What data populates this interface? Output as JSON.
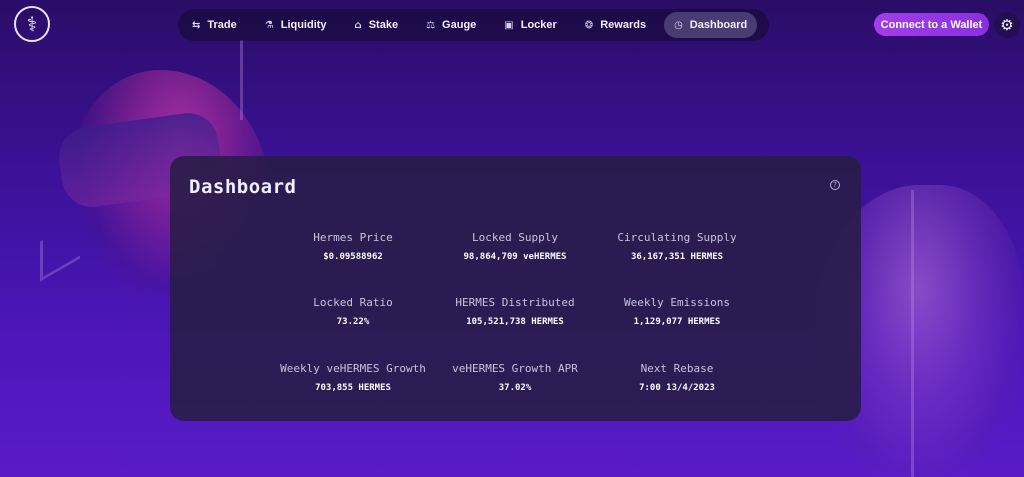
{
  "nav": {
    "items": [
      {
        "label": "Trade",
        "icon": "swap-arrows-icon",
        "glyph": "⇆"
      },
      {
        "label": "Liquidity",
        "icon": "flask-icon",
        "glyph": "⚗"
      },
      {
        "label": "Stake",
        "icon": "bank-icon",
        "glyph": "⌂"
      },
      {
        "label": "Gauge",
        "icon": "scales-icon",
        "glyph": "⚖"
      },
      {
        "label": "Locker",
        "icon": "lockbox-icon",
        "glyph": "▣"
      },
      {
        "label": "Rewards",
        "icon": "coins-icon",
        "glyph": "❂"
      },
      {
        "label": "Dashboard",
        "icon": "dashboard-icon",
        "glyph": "◷"
      }
    ],
    "active": "Dashboard"
  },
  "header": {
    "connect_label": "Connect to a Wallet",
    "logo_glyph": "⚕",
    "gear_glyph": "⚙"
  },
  "dashboard": {
    "title": "Dashboard",
    "help_glyph": "?",
    "stats": [
      {
        "label": "Hermes Price",
        "value": "$0.09588962"
      },
      {
        "label": "Locked Supply",
        "value": "98,864,709 veHERMES"
      },
      {
        "label": "Circulating Supply",
        "value": "36,167,351 HERMES"
      },
      {
        "label": "Locked Ratio",
        "value": "73.22%"
      },
      {
        "label": "HERMES Distributed",
        "value": "105,521,738 HERMES"
      },
      {
        "label": "Weekly Emissions",
        "value": "1,129,077 HERMES"
      },
      {
        "label": "Weekly veHERMES Growth",
        "value": "703,855 HERMES"
      },
      {
        "label": "veHERMES Growth APR",
        "value": "37.02%"
      },
      {
        "label": "Next Rebase",
        "value": "7:00 13/4/2023"
      }
    ]
  },
  "colors": {
    "accent": "#9b39e6",
    "card": "#281c46",
    "background": "#3b1196"
  }
}
